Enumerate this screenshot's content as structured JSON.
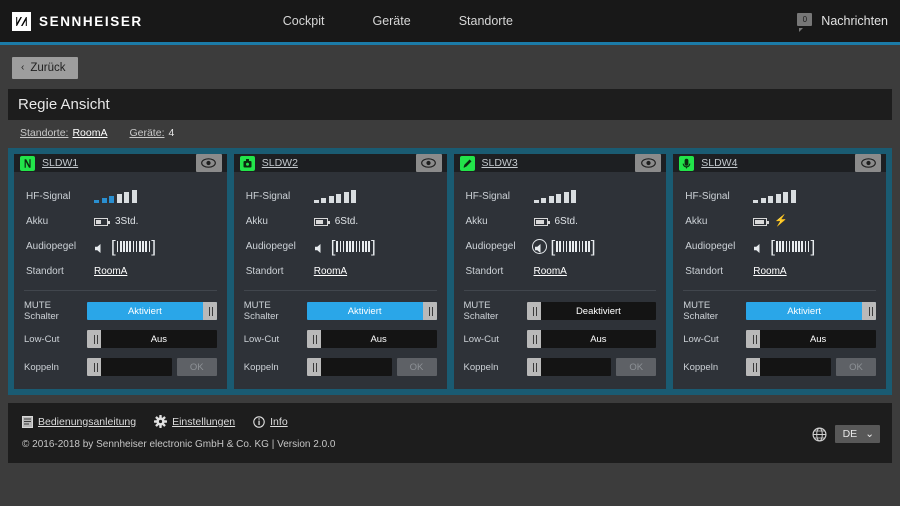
{
  "header": {
    "brand": "SENNHEISER",
    "nav": [
      {
        "label": "Cockpit"
      },
      {
        "label": "Geräte"
      },
      {
        "label": "Standorte"
      }
    ],
    "messages_count": "0",
    "messages_label": "Nachrichten"
  },
  "back_button": {
    "label": "Zurück",
    "chevron": "‹"
  },
  "page": {
    "title": "Regie Ansicht"
  },
  "breadcrumb": {
    "location_key": "Standorte:",
    "location_value": "RoomA",
    "devices_key": "Geräte:",
    "devices_value": "4"
  },
  "labels": {
    "hf_signal": "HF-Signal",
    "battery": "Akku",
    "audio_level": "Audiopegel",
    "location": "Standort",
    "mute_switch": "MUTE Schalter",
    "low_cut": "Low-Cut",
    "link": "Koppeln",
    "ok": "OK"
  },
  "devices": [
    {
      "name": "SLDW1",
      "icon": "handheld-mic-icon",
      "signal_bars": 6,
      "signal_active": 3,
      "battery_level": 45,
      "battery_text": "3Std.",
      "charging": false,
      "audio_muted": false,
      "audio_ticks": 11,
      "location": "RoomA",
      "mute_state": "on",
      "mute_label": "Aktiviert",
      "lowcut_state": "off",
      "lowcut_label": "Aus",
      "link_state": "empty",
      "link_label": ""
    },
    {
      "name": "SLDW2",
      "icon": "bodypack-icon",
      "signal_bars": 6,
      "signal_active": 0,
      "battery_level": 70,
      "battery_text": "6Std.",
      "charging": false,
      "audio_muted": false,
      "audio_ticks": 11,
      "location": "RoomA",
      "mute_state": "on",
      "mute_label": "Aktiviert",
      "lowcut_state": "off",
      "lowcut_label": "Aus",
      "link_state": "empty",
      "link_label": ""
    },
    {
      "name": "SLDW3",
      "icon": "pencil-mic-icon",
      "signal_bars": 6,
      "signal_active": 0,
      "battery_level": 85,
      "battery_text": "6Std.",
      "charging": false,
      "audio_muted": true,
      "audio_ticks": 11,
      "location": "RoomA",
      "mute_state": "off",
      "mute_label": "Deaktiviert",
      "lowcut_state": "off",
      "lowcut_label": "Aus",
      "link_state": "empty",
      "link_label": ""
    },
    {
      "name": "SLDW4",
      "icon": "capsule-mic-icon",
      "signal_bars": 6,
      "signal_active": 0,
      "battery_level": 85,
      "battery_text": "",
      "charging": true,
      "audio_muted": false,
      "audio_ticks": 11,
      "location": "RoomA",
      "mute_state": "on",
      "mute_label": "Aktiviert",
      "lowcut_state": "off",
      "lowcut_label": "Aus",
      "link_state": "empty",
      "link_label": ""
    }
  ],
  "footer": {
    "links": [
      {
        "label": "Bedienungsanleitung",
        "icon": "manual-document-icon"
      },
      {
        "label": "Einstellungen",
        "icon": "gear-icon"
      },
      {
        "label": "Info",
        "icon": "info-circle-icon"
      }
    ],
    "copyright": "© 2016-2018 by Sennheiser electronic GmbH & Co. KG | Version 2.0.0",
    "language": "DE",
    "language_chevron": "⌄",
    "globe_icon": "globe-icon"
  },
  "colors": {
    "accent_blue": "#1b7ba8",
    "toggle_on": "#2aa6e8",
    "device_green": "#22e44a",
    "card_frame": "#1a5b72",
    "signal_active": "#2a8fd0"
  }
}
